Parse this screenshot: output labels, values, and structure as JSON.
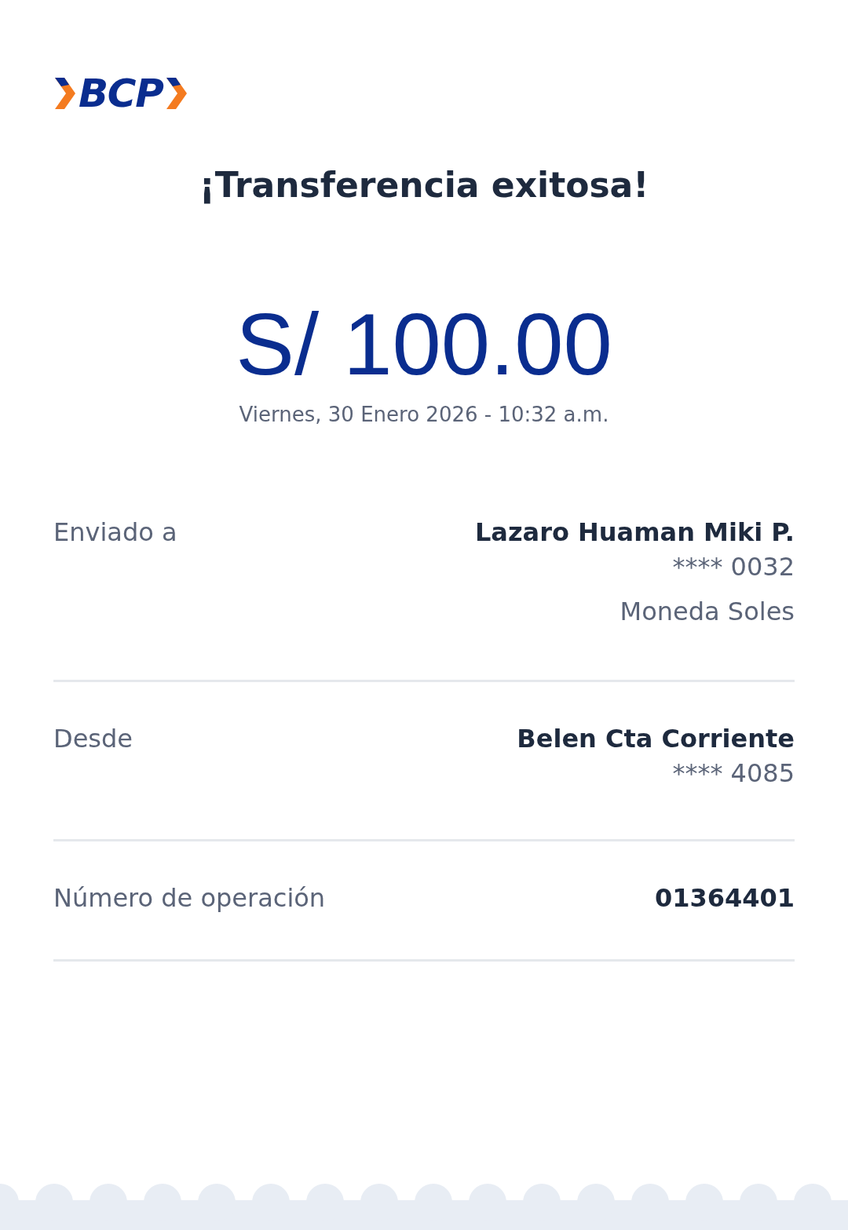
{
  "logo": {
    "text": "BCP"
  },
  "title": "¡Transferencia exitosa!",
  "amount": "S/ 100.00",
  "datetime": "Viernes, 30 Enero 2026 - 10:32 a.m.",
  "details": [
    {
      "label": "Enviado a",
      "lines": [
        {
          "kind": "name",
          "text": "Lazaro Huaman Miki P."
        },
        {
          "kind": "account",
          "text": "**** 0032"
        },
        {
          "kind": "note",
          "text": "Moneda Soles"
        }
      ]
    },
    {
      "label": "Desde",
      "lines": [
        {
          "kind": "name",
          "text": "Belen Cta Corriente"
        },
        {
          "kind": "account",
          "text": "**** 4085"
        }
      ]
    },
    {
      "label": "Número de operación",
      "lines": [
        {
          "kind": "name",
          "text": "01364401"
        }
      ]
    }
  ]
}
